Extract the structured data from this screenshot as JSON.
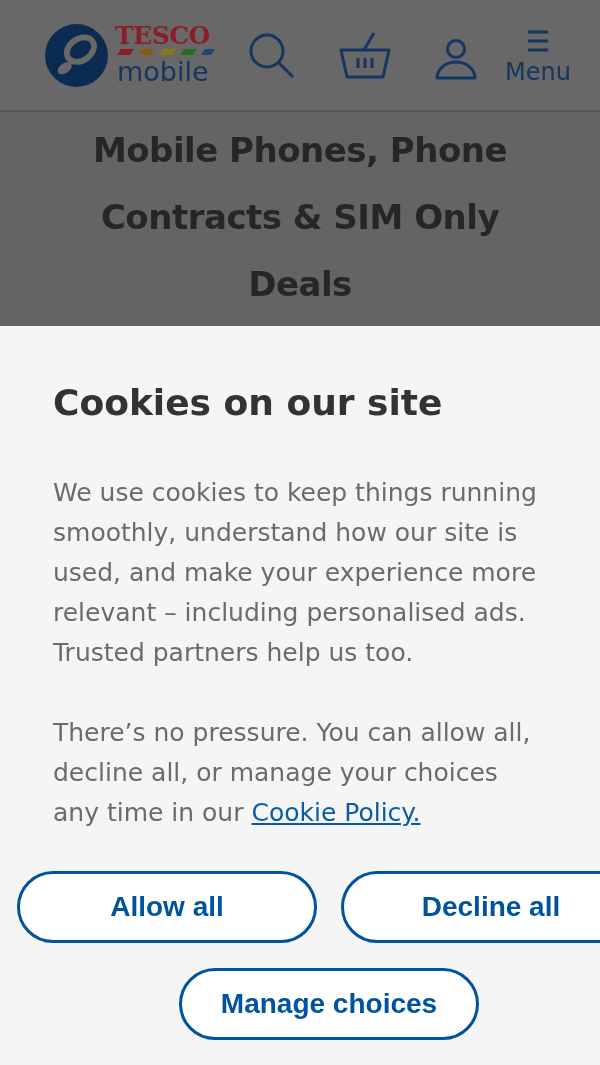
{
  "header": {
    "logo": {
      "brand": "TESCO",
      "product": "mobile"
    },
    "menu_label": "Menu"
  },
  "page_title": "Mobile Phones, Phone Contracts & SIM Only Deals",
  "cookie_banner": {
    "title": "Cookies on our site",
    "paragraphs": [
      {
        "text": "We use cookies to keep things running smoothly, understand how our site is used, and make your experience more relevant – including personalised ads. Trusted partners help us too."
      },
      {
        "text": "There’s no pressure. You can allow all, decline all, or manage your choices any time in our",
        "link": "Cookie Policy."
      }
    ],
    "buttons": [
      {
        "label": "Allow all"
      },
      {
        "label": "Decline all"
      },
      {
        "label": "Manage choices"
      }
    ]
  }
}
